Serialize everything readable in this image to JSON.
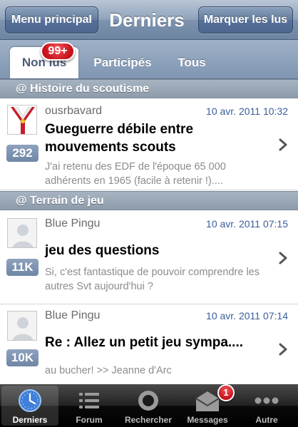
{
  "navbar": {
    "title": "Derniers",
    "left_button": "Menu principal",
    "right_button": "Marquer les lus"
  },
  "segments": {
    "items": [
      {
        "label": "Non lus",
        "active": true
      },
      {
        "label": "Participés",
        "active": false
      },
      {
        "label": "Tous",
        "active": false
      }
    ],
    "unread_badge": "99+"
  },
  "sections": [
    {
      "title": "@ Histoire du scoutisme",
      "rows": [
        {
          "author": "ousrbavard",
          "date": "10 avr. 2011 10:32",
          "subject": "Gueguerre débile entre mouvements scouts",
          "preview": "J'ai retenu des EDF de l'époque 65 000 adhérents en 1965 (facile à retenir !)....",
          "count": "292",
          "avatar_icon": "scout-scarf-icon"
        }
      ]
    },
    {
      "title": "@ Terrain de jeu",
      "rows": [
        {
          "author": "Blue Pingu",
          "date": "10 avr. 2011 07:15",
          "subject": "jeu des questions",
          "preview": "Si, c'est fantastique de pouvoir comprendre les autres Svt aujourd'hui ?",
          "count": "11K",
          "avatar_icon": "default-avatar-icon"
        },
        {
          "author": "Blue Pingu",
          "date": "10 avr. 2011 07:14",
          "subject": "Re : Allez un petit jeu sympa....",
          "preview": "au bucher! >> Jeanne d'Arc",
          "count": "10K",
          "avatar_icon": "default-avatar-icon"
        }
      ]
    }
  ],
  "tabbar": {
    "items": [
      {
        "label": "Derniers",
        "icon": "clock-icon",
        "active": true
      },
      {
        "label": "Forum",
        "icon": "list-icon",
        "active": false
      },
      {
        "label": "Rechercher",
        "icon": "search-icon",
        "active": false
      },
      {
        "label": "Messages",
        "icon": "envelope-icon",
        "active": false
      },
      {
        "label": "Autre",
        "icon": "more-icon",
        "active": false
      }
    ],
    "messages_badge": "1"
  },
  "colors": {
    "navbar": "#7d93ae",
    "section_header": "#98a5b5",
    "date": "#3a5e9a",
    "badge": "#d4151e",
    "count_badge": "#7f95b1"
  }
}
